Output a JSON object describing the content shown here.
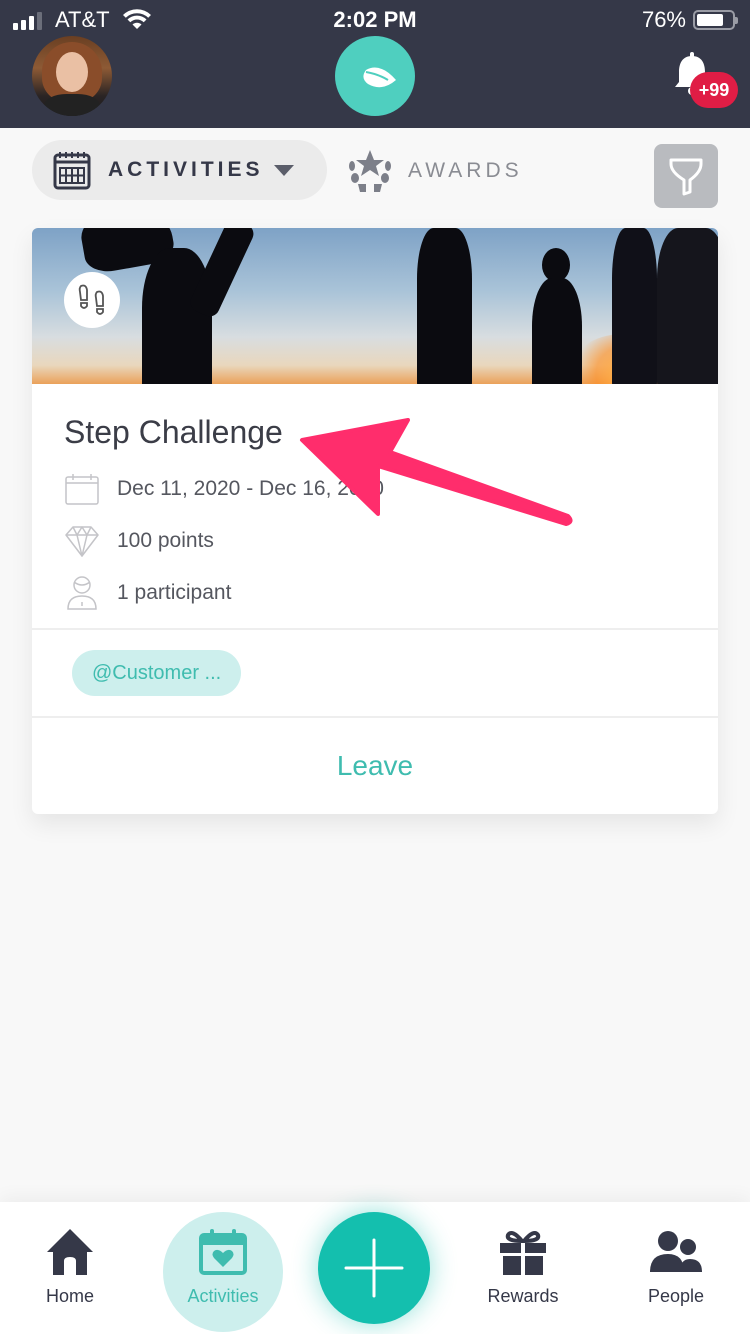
{
  "status_bar": {
    "carrier": "AT&T",
    "time": "2:02 PM",
    "battery_percent": "76%",
    "battery_level": 0.76
  },
  "header": {
    "avatar_icon": "user-avatar",
    "logo_icon": "leaf-icon",
    "notifications_icon": "bell-icon",
    "notifications_badge": "+99"
  },
  "tabs": {
    "activities_label": "ACTIVITIES",
    "awards_label": "AWARDS",
    "filter_icon": "filter-icon"
  },
  "activity_card": {
    "category_icon": "footprints-icon",
    "title": "Step Challenge",
    "date_range": "Dec 11, 2020 - Dec 16, 2020",
    "points": "100 points",
    "participants": "1 participant",
    "tags": [
      "@Customer ..."
    ],
    "action_label": "Leave"
  },
  "bottom_nav": {
    "items": [
      {
        "label": "Home",
        "icon": "home-icon"
      },
      {
        "label": "Activities",
        "icon": "calendar-heart-icon"
      },
      {
        "label": "Rewards",
        "icon": "gift-icon"
      },
      {
        "label": "People",
        "icon": "people-icon"
      }
    ],
    "fab_icon": "plus-icon",
    "active": "Activities"
  },
  "colors": {
    "header_bg": "#353848",
    "accent": "#4fcfbf",
    "accent_dark": "#14bfae",
    "accent_text": "#3fbcaf",
    "badge_red": "#e01d45",
    "annotation_arrow": "#ff2d6c"
  }
}
